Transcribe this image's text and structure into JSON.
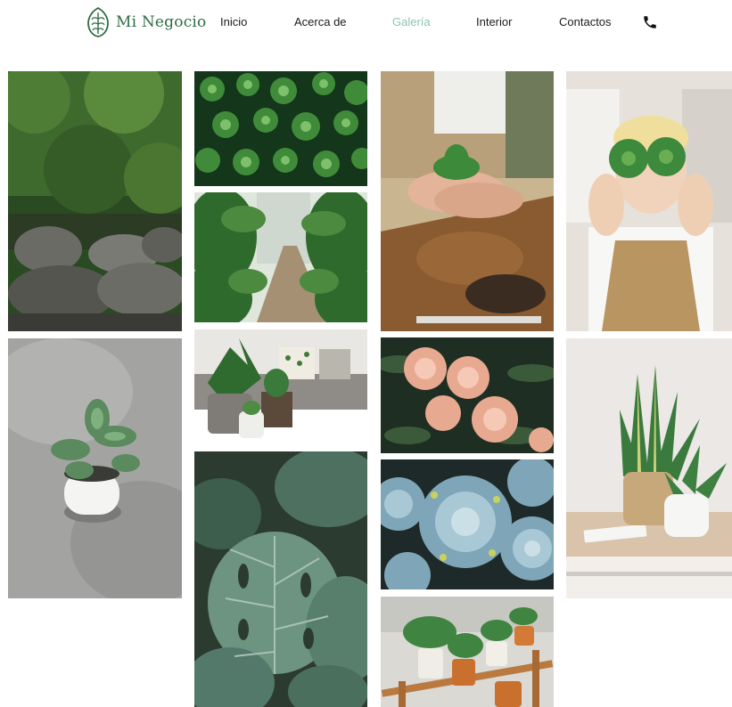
{
  "brand": {
    "name": "Mi Negocio",
    "logo_icon": "leaf-emblem-icon",
    "color": "#2f6b45"
  },
  "nav": {
    "items": [
      {
        "label": "Inicio",
        "active": false
      },
      {
        "label": "Acerca de",
        "active": false
      },
      {
        "label": "Galería",
        "active": true
      },
      {
        "label": "Interior",
        "active": false
      },
      {
        "label": "Contactos",
        "active": false
      }
    ],
    "phone_icon": "phone-icon",
    "active_color": "#8fc3ad"
  },
  "gallery": {
    "images": [
      {
        "subject": "jungle-stream-rocks"
      },
      {
        "subject": "succulent-groundcover"
      },
      {
        "subject": "hands-holding-succulent"
      },
      {
        "subject": "woman-holding-succulents"
      },
      {
        "subject": "tropical-garden-path"
      },
      {
        "subject": "sofa-with-potted-plants"
      },
      {
        "subject": "peach-carnation-flowers"
      },
      {
        "subject": "potted-succulent-gray-background"
      },
      {
        "subject": "blue-echeveria-succulents"
      },
      {
        "subject": "snake-plant-on-desk"
      },
      {
        "subject": "monstera-leaves"
      },
      {
        "subject": "plants-on-wooden-shelf"
      }
    ]
  }
}
